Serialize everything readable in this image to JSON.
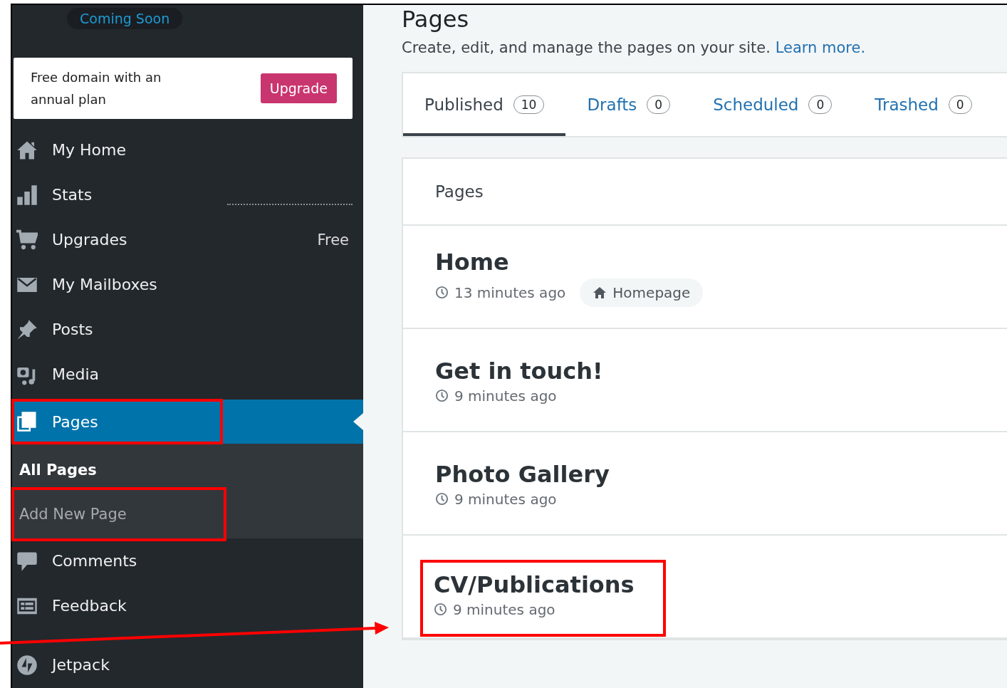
{
  "sidebar": {
    "site_status": "Coming Soon",
    "promo": {
      "text": "Free domain with an annual plan",
      "button": "Upgrade"
    },
    "items": [
      {
        "kind": "home",
        "label": "My Home",
        "selected": false,
        "highlighted": false
      },
      {
        "kind": "stats",
        "label": "Stats",
        "selected": false,
        "highlighted": false
      },
      {
        "kind": "cart",
        "label": "Upgrades",
        "badge": "Free",
        "selected": false,
        "highlighted": false
      },
      {
        "kind": "mail",
        "label": "My Mailboxes",
        "selected": false,
        "highlighted": false
      },
      {
        "kind": "pin",
        "label": "Posts",
        "selected": false,
        "highlighted": false
      },
      {
        "kind": "media",
        "label": "Media",
        "selected": false,
        "highlighted": false
      },
      {
        "kind": "pages",
        "label": "Pages",
        "selected": true,
        "highlighted": true,
        "children": [
          {
            "label": "All Pages",
            "selected": true,
            "highlighted": false
          },
          {
            "label": "Add New Page",
            "selected": false,
            "highlighted": true
          }
        ]
      },
      {
        "kind": "comment",
        "label": "Comments",
        "selected": false,
        "highlighted": false
      },
      {
        "kind": "feedback",
        "label": "Feedback",
        "selected": false,
        "highlighted": false
      },
      {
        "kind": "jetpack",
        "label": "Jetpack",
        "selected": false,
        "highlighted": false
      }
    ]
  },
  "header": {
    "title": "Pages",
    "subtitle": "Create, edit, and manage the pages on your site.",
    "link": "Learn more."
  },
  "tabs": [
    {
      "label": "Published",
      "count": "10",
      "selected": true
    },
    {
      "label": "Drafts",
      "count": "0",
      "selected": false
    },
    {
      "label": "Scheduled",
      "count": "0",
      "selected": false
    },
    {
      "label": "Trashed",
      "count": "0",
      "selected": false
    }
  ],
  "list": {
    "heading": "Pages",
    "rows": [
      {
        "title": "Home",
        "time": "13 minutes ago",
        "tag": "Homepage",
        "highlighted": false
      },
      {
        "title": "Get in touch!",
        "time": "9 minutes ago",
        "highlighted": false
      },
      {
        "title": "Photo Gallery",
        "time": "9 minutes ago",
        "highlighted": false
      },
      {
        "title": "CV/Publications",
        "time": "9 minutes ago",
        "highlighted": true
      }
    ]
  },
  "pointer_arrow": true
}
